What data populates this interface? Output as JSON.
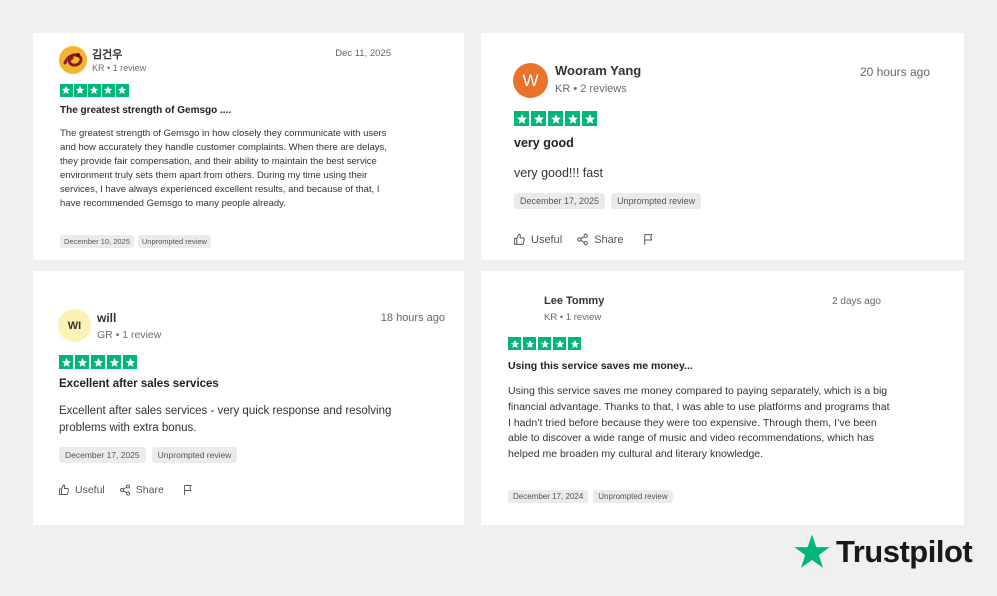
{
  "brand": {
    "name": "Trustpilot",
    "star_color": "#00b67a"
  },
  "reviews": [
    {
      "author": "김건우",
      "meta": "KR • 1 review",
      "date": "Dec 11, 2025",
      "rating": 5,
      "title": "The greatest strength of Gemsgo ....",
      "body": "The greatest strength of Gemsgo in how closely they communicate with users and how accurately they handle customer complaints. When there are delays, they provide fair compensation, and their ability to maintain the best service environment truly sets them apart from others. During my time using their services, I have always experienced excellent results, and because of that, I have recommended Gemsgo to many people already.",
      "experience_date": "December 10, 2025",
      "tag": "Unprompted review",
      "avatar": "photo"
    },
    {
      "author": "Wooram Yang",
      "meta": "KR • 2 reviews",
      "date": "20 hours ago",
      "rating": 5,
      "title": "very good",
      "body": "very good!!! fast",
      "experience_date": "December 17, 2025",
      "tag": "Unprompted review",
      "avatar_initials": "W",
      "avatar_color": "#e8742b",
      "useful_label": "Useful",
      "share_label": "Share"
    },
    {
      "author": "will",
      "meta": "GR • 1 review",
      "date": "18 hours ago",
      "rating": 5,
      "title": "Excellent after sales services",
      "body": "Excellent after sales services - very quick response and resolving problems with extra bonus.",
      "experience_date": "December 17, 2025",
      "tag": "Unprompted review",
      "avatar_initials": "WI",
      "avatar_color": "#fdf2b5",
      "useful_label": "Useful",
      "share_label": "Share"
    },
    {
      "author": "Lee Tommy",
      "meta": "KR • 1 review",
      "date": "2 days ago",
      "rating": 5,
      "title": "Using this service saves me money...",
      "body": "Using this service saves me money compared to paying separately, which is a big financial advantage. Thanks to that, I was able to use platforms and programs that I hadn’t tried before because they were too expensive. Through them, I’ve been able to discover a wide range of music and video recommendations, which has helped me broaden my cultural and literary knowledge.",
      "experience_date": "December 17, 2024",
      "tag": "Unprompted review"
    }
  ]
}
